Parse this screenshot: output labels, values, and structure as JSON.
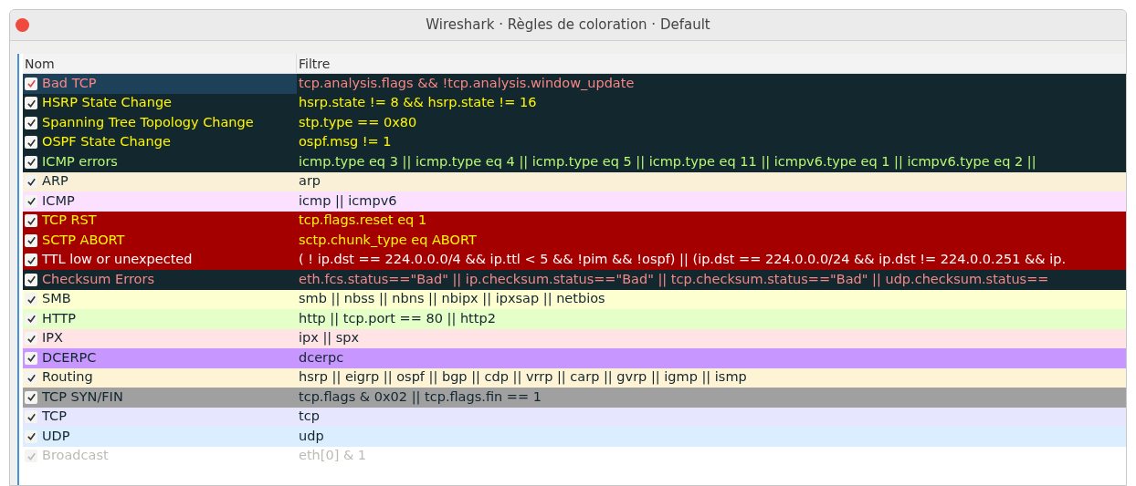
{
  "window": {
    "title": "Wireshark · Règles de coloration · Default"
  },
  "table": {
    "columns": [
      "Nom",
      "Filtre"
    ],
    "rows": [
      {
        "name": "Bad TCP",
        "filter": "tcp.analysis.flags && !tcp.analysis.window_update",
        "checked": true,
        "disabled": false,
        "selected": true,
        "color": "#12272e",
        "kind": "bad"
      },
      {
        "name": "HSRP State Change",
        "filter": "hsrp.state != 8 && hsrp.state != 16",
        "checked": true,
        "disabled": false,
        "selected": false,
        "color": "#12272e",
        "kind": "warn"
      },
      {
        "name": "Spanning Tree Topology  Change",
        "filter": "stp.type == 0x80",
        "checked": true,
        "disabled": false,
        "selected": false,
        "color": "#12272e",
        "kind": "warn"
      },
      {
        "name": "OSPF State Change",
        "filter": "ospf.msg != 1",
        "checked": true,
        "disabled": false,
        "selected": false,
        "color": "#12272e",
        "kind": "warn"
      },
      {
        "name": "ICMP errors",
        "filter": "icmp.type eq 3 || icmp.type eq 4 || icmp.type eq 5 || icmp.type eq 11 || icmpv6.type eq 1 || icmpv6.type eq 2 ||",
        "checked": true,
        "disabled": false,
        "selected": false,
        "color": "#12272e",
        "kind": "error"
      },
      {
        "name": "ARP",
        "filter": "arp",
        "checked": true,
        "disabled": false,
        "selected": false,
        "color": "#faf0d7",
        "kind": "plain"
      },
      {
        "name": "ICMP",
        "filter": "icmp || icmpv6",
        "checked": true,
        "disabled": false,
        "selected": false,
        "color": "#fce0ff",
        "kind": "plain"
      },
      {
        "name": "TCP RST",
        "filter": "tcp.flags.reset eq 1",
        "checked": true,
        "disabled": false,
        "selected": false,
        "color": "#a40000",
        "kind": "warn"
      },
      {
        "name": "SCTP ABORT",
        "filter": "sctp.chunk_type eq ABORT",
        "checked": true,
        "disabled": false,
        "selected": false,
        "color": "#a40000",
        "kind": "warn"
      },
      {
        "name": "TTL low or unexpected",
        "filter": "( ! ip.dst == 224.0.0.0/4 && ip.ttl < 5 && !pim && !ospf) || (ip.dst == 224.0.0.0/24 && ip.dst != 224.0.0.251 && ip.",
        "checked": true,
        "disabled": false,
        "selected": false,
        "color": "#a40000",
        "kind": "critical"
      },
      {
        "name": "Checksum Errors",
        "filter": "eth.fcs.status==\"Bad\" || ip.checksum.status==\"Bad\" || tcp.checksum.status==\"Bad\" || udp.checksum.status==",
        "checked": true,
        "disabled": false,
        "selected": false,
        "color": "#12272e",
        "kind": "bad"
      },
      {
        "name": "SMB",
        "filter": "smb || nbss || nbns || nbipx || ipxsap || netbios",
        "checked": true,
        "disabled": false,
        "selected": false,
        "color": "#feffd0",
        "kind": "plain"
      },
      {
        "name": "HTTP",
        "filter": "http || tcp.port == 80 || http2",
        "checked": true,
        "disabled": false,
        "selected": false,
        "color": "#e4ffc7",
        "kind": "plain"
      },
      {
        "name": "IPX",
        "filter": "ipx || spx",
        "checked": true,
        "disabled": false,
        "selected": false,
        "color": "#ffe3e5",
        "kind": "plain"
      },
      {
        "name": "DCERPC",
        "filter": "dcerpc",
        "checked": true,
        "disabled": false,
        "selected": false,
        "color": "#c797ff",
        "kind": "plain"
      },
      {
        "name": "Routing",
        "filter": "hsrp || eigrp || ospf || bgp || cdp || vrrp || carp || gvrp || igmp || ismp",
        "checked": true,
        "disabled": false,
        "selected": false,
        "color": "#fff3d6",
        "kind": "plain"
      },
      {
        "name": "TCP SYN/FIN",
        "filter": "tcp.flags & 0x02 || tcp.flags.fin == 1",
        "checked": true,
        "disabled": false,
        "selected": false,
        "color": "#a0a0a0",
        "kind": "plain"
      },
      {
        "name": "TCP",
        "filter": "tcp",
        "checked": true,
        "disabled": false,
        "selected": false,
        "color": "#e7e6ff",
        "kind": "plain"
      },
      {
        "name": "UDP",
        "filter": "udp",
        "checked": true,
        "disabled": false,
        "selected": false,
        "color": "#daeeff",
        "kind": "plain"
      },
      {
        "name": "Broadcast",
        "filter": "eth[0] & 1",
        "checked": true,
        "disabled": true,
        "selected": false,
        "color": "#ffffff"
      }
    ]
  }
}
